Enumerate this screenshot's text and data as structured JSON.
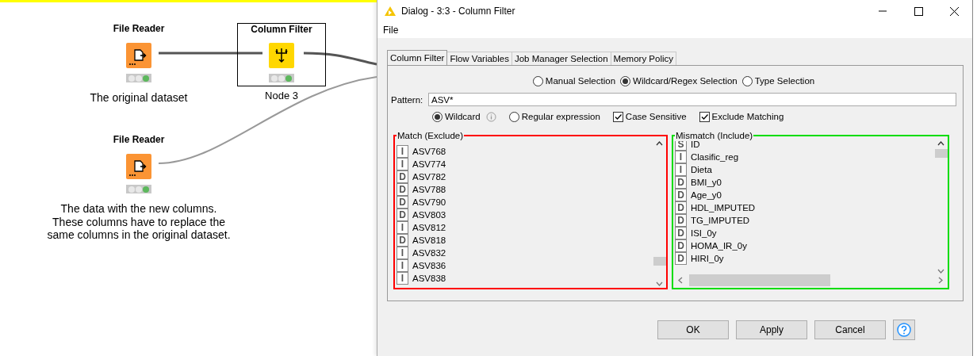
{
  "canvas": {
    "nodes": [
      {
        "title": "File Reader",
        "kind": "reader",
        "selected": false,
        "executed": true,
        "annotation": "The original dataset"
      },
      {
        "title": "Column Filter",
        "kind": "filter",
        "selected": true,
        "executed": true,
        "annotation": "Node 3"
      },
      {
        "title": "File Reader",
        "kind": "reader",
        "selected": false,
        "executed": true,
        "annotation": "The data with the new columns.\nThese columns have to replace the\nsame columns in the original dataset."
      }
    ]
  },
  "dialog": {
    "title": "Dialog - 3:3 - Column Filter",
    "menu": [
      "File"
    ],
    "tabs": [
      {
        "label": "Column Filter",
        "selected": true
      },
      {
        "label": "Flow Variables",
        "selected": false
      },
      {
        "label": "Job Manager Selection",
        "selected": false
      },
      {
        "label": "Memory Policy",
        "selected": false
      }
    ],
    "modes": [
      {
        "label": "Manual Selection",
        "selected": false
      },
      {
        "label": "Wildcard/Regex Selection",
        "selected": true
      },
      {
        "label": "Type Selection",
        "selected": false
      }
    ],
    "pattern": {
      "label": "Pattern:",
      "value": "ASV*"
    },
    "options": [
      {
        "kind": "radio",
        "label": "Wildcard",
        "selected": true,
        "info": true
      },
      {
        "kind": "radio",
        "label": "Regular expression",
        "selected": false,
        "info": false
      },
      {
        "kind": "checkbox",
        "label": "Case Sensitive",
        "checked": true
      },
      {
        "kind": "checkbox",
        "label": "Exclude Matching",
        "checked": true
      }
    ],
    "lists": [
      {
        "title": "Match (Exclude)",
        "color": "#ff0000",
        "items": [
          {
            "type": "I",
            "name": "ASV768"
          },
          {
            "type": "I",
            "name": "ASV774"
          },
          {
            "type": "D",
            "name": "ASV782"
          },
          {
            "type": "D",
            "name": "ASV788"
          },
          {
            "type": "D",
            "name": "ASV790"
          },
          {
            "type": "D",
            "name": "ASV803"
          },
          {
            "type": "I",
            "name": "ASV812"
          },
          {
            "type": "D",
            "name": "ASV818"
          },
          {
            "type": "I",
            "name": "ASV832"
          },
          {
            "type": "I",
            "name": "ASV836"
          },
          {
            "type": "I",
            "name": "ASV838"
          }
        ]
      },
      {
        "title": "Mismatch (Include)",
        "color": "#00dd00",
        "items": [
          {
            "type": "S",
            "name": "ID"
          },
          {
            "type": "I",
            "name": "Clasific_reg"
          },
          {
            "type": "I",
            "name": "Dieta"
          },
          {
            "type": "D",
            "name": "BMI_y0"
          },
          {
            "type": "D",
            "name": "Age_y0"
          },
          {
            "type": "D",
            "name": "HDL_IMPUTED"
          },
          {
            "type": "D",
            "name": "TG_IMPUTED"
          },
          {
            "type": "D",
            "name": "ISI_0y"
          },
          {
            "type": "D",
            "name": "HOMA_IR_0y"
          },
          {
            "type": "D",
            "name": "HIRI_0y"
          }
        ]
      }
    ],
    "buttons": [
      "OK",
      "Apply",
      "Cancel"
    ]
  }
}
